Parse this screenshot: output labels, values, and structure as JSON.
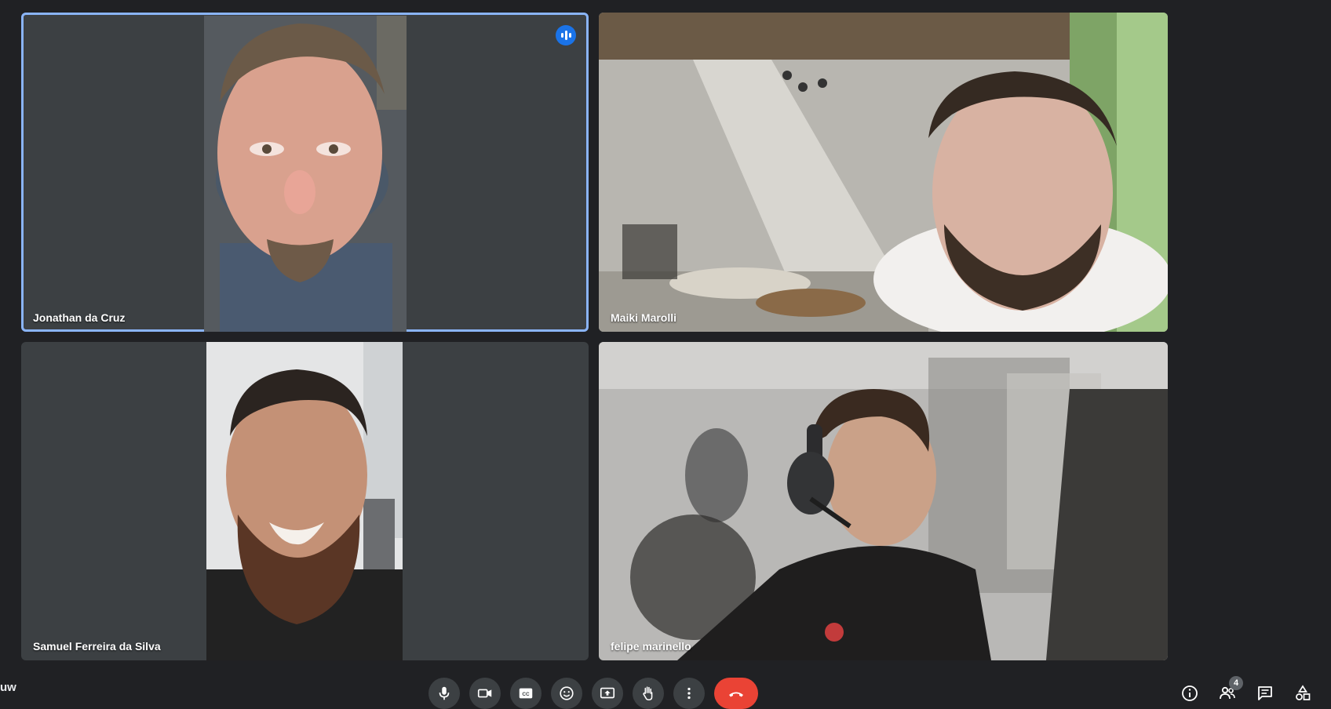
{
  "meeting": {
    "code_fragment": "uw",
    "participant_count": "4"
  },
  "participants": [
    {
      "name": "Jonathan da Cruz",
      "speaking": true
    },
    {
      "name": "Maiki Marolli",
      "speaking": false
    },
    {
      "name": "Samuel Ferreira da Silva",
      "speaking": false
    },
    {
      "name": "felipe marinello",
      "speaking": false
    }
  ],
  "controls": {
    "microphone": "mic-icon",
    "camera": "camera-icon",
    "captions": "closed-captions-icon",
    "reactions": "emoji-icon",
    "present": "present-screen-icon",
    "raise_hand": "hand-icon",
    "more": "more-vert-icon",
    "leave": "call-end-icon"
  },
  "side_controls": {
    "info": "info-icon",
    "people": "people-icon",
    "chat": "chat-icon",
    "activities": "activities-icon"
  },
  "colors": {
    "background": "#202124",
    "tile": "#3c4043",
    "active_border": "#8ab4f8",
    "speaking_indicator": "#1a73e8",
    "hangup": "#ea4335"
  }
}
